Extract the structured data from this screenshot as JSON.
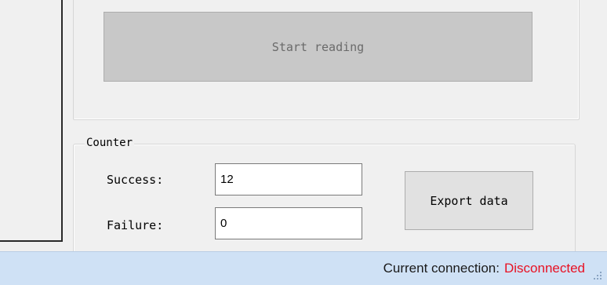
{
  "start_button": {
    "label": "Start reading"
  },
  "counter": {
    "title": "Counter",
    "success_label": "Success:",
    "success_value": "12",
    "failure_label": "Failure:",
    "failure_value": "0",
    "export_label": "Export data"
  },
  "status_bar": {
    "connection_label": "Current connection:",
    "connection_value": "Disconnected",
    "colors": {
      "value": "#e81123",
      "background": "#cfe1f5"
    }
  },
  "icons": {
    "grip": "resize-grip-icon"
  }
}
